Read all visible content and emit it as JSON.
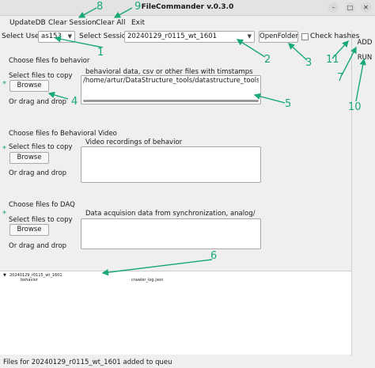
{
  "window": {
    "title": "FileCommander v.0.3.0",
    "minimize": "–",
    "maximize": "□",
    "close": "✕"
  },
  "menu": {
    "update_db": "UpdateDB",
    "clear_session": "Clear Session",
    "clear_all": "Clear All",
    "exit": "Exit"
  },
  "toolbar": {
    "select_user_label": "Select User",
    "user_value": "as153",
    "select_session_label": "Select Session",
    "session_value": "20240129_r0115_wt_1601",
    "open_folder": "OpenFolder",
    "check_hashes": "Check hashes"
  },
  "side": {
    "add": "ADD",
    "run": "RUN"
  },
  "sections": [
    {
      "title": "Choose files fo  behavior",
      "select_label": "Select files to copy",
      "browse": "Browse",
      "drag_label": "Or drag and drop",
      "description": "behavioral data, csv or other files with timstamps",
      "path": "/home/artur/DataStructure_tools/datastructure_tools/crawler_log.json"
    },
    {
      "title": "Choose files fo  Behavioral Video",
      "select_label": "Select files to copy",
      "browse": "Browse",
      "drag_label": "Or drag and drop",
      "description": "Video recordings of behavior",
      "path": ""
    },
    {
      "title": "Choose files fo  DAQ",
      "select_label": "Select files to copy",
      "browse": "Browse",
      "drag_label": "Or drag and drop",
      "description": "Data acquision data from synchronization, analog/",
      "path": ""
    }
  ],
  "tree": {
    "root": "20240129_r0115_wt_1601",
    "child": "behavior",
    "file": "crawler_log.json"
  },
  "status": "Files for 20240129_r0115_wt_1601 added to queu",
  "annotations": {
    "n1": "1",
    "n2": "2",
    "n3": "3",
    "n4": "4",
    "n5": "5",
    "n6": "6",
    "n7": "7",
    "n8": "8",
    "n9": "9",
    "n10": "10",
    "n11": "11",
    "star": "*"
  },
  "colors": {
    "annotation": "#19a974",
    "background": "#efefef"
  }
}
